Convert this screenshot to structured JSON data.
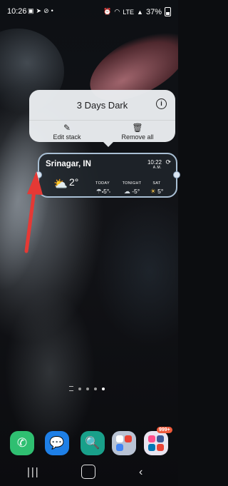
{
  "status_bar": {
    "time": "10:26",
    "battery": "37%",
    "left_icons": [
      "gallery-icon",
      "telegram-icon",
      "location-icon",
      "dot-icon"
    ],
    "right_icons": [
      "alarm-icon",
      "wifi-icon",
      "volte-icon",
      "signal-icon",
      "battery-icon"
    ],
    "network_label": "LTE"
  },
  "stack_popup": {
    "title": "3 Days Dark",
    "edit_label": "Edit stack",
    "remove_label": "Remove all"
  },
  "weather_widget": {
    "location": "Srinagar, IN",
    "time": "10:22",
    "am_pm": "A.M.",
    "current_temp": "2°",
    "forecast": [
      {
        "label": "TODAY",
        "temp": "5°",
        "icon": "rain-cloud-icon"
      },
      {
        "label": "TONIGHT",
        "temp": "-5°",
        "icon": "cloud-icon"
      },
      {
        "label": "SAT",
        "temp": "5°",
        "icon": "partly-sunny-icon"
      }
    ]
  },
  "dock": {
    "folder_badge": "999+",
    "apps": [
      "phone-app",
      "messages-app",
      "bixby-vision-app",
      "google-folder",
      "store-folder"
    ]
  },
  "colors": {
    "popup_bg": "#e9ecef",
    "widget_border": "#a9bfd4",
    "annotation_arrow": "#e53935",
    "badge": "#ef5a3b"
  }
}
